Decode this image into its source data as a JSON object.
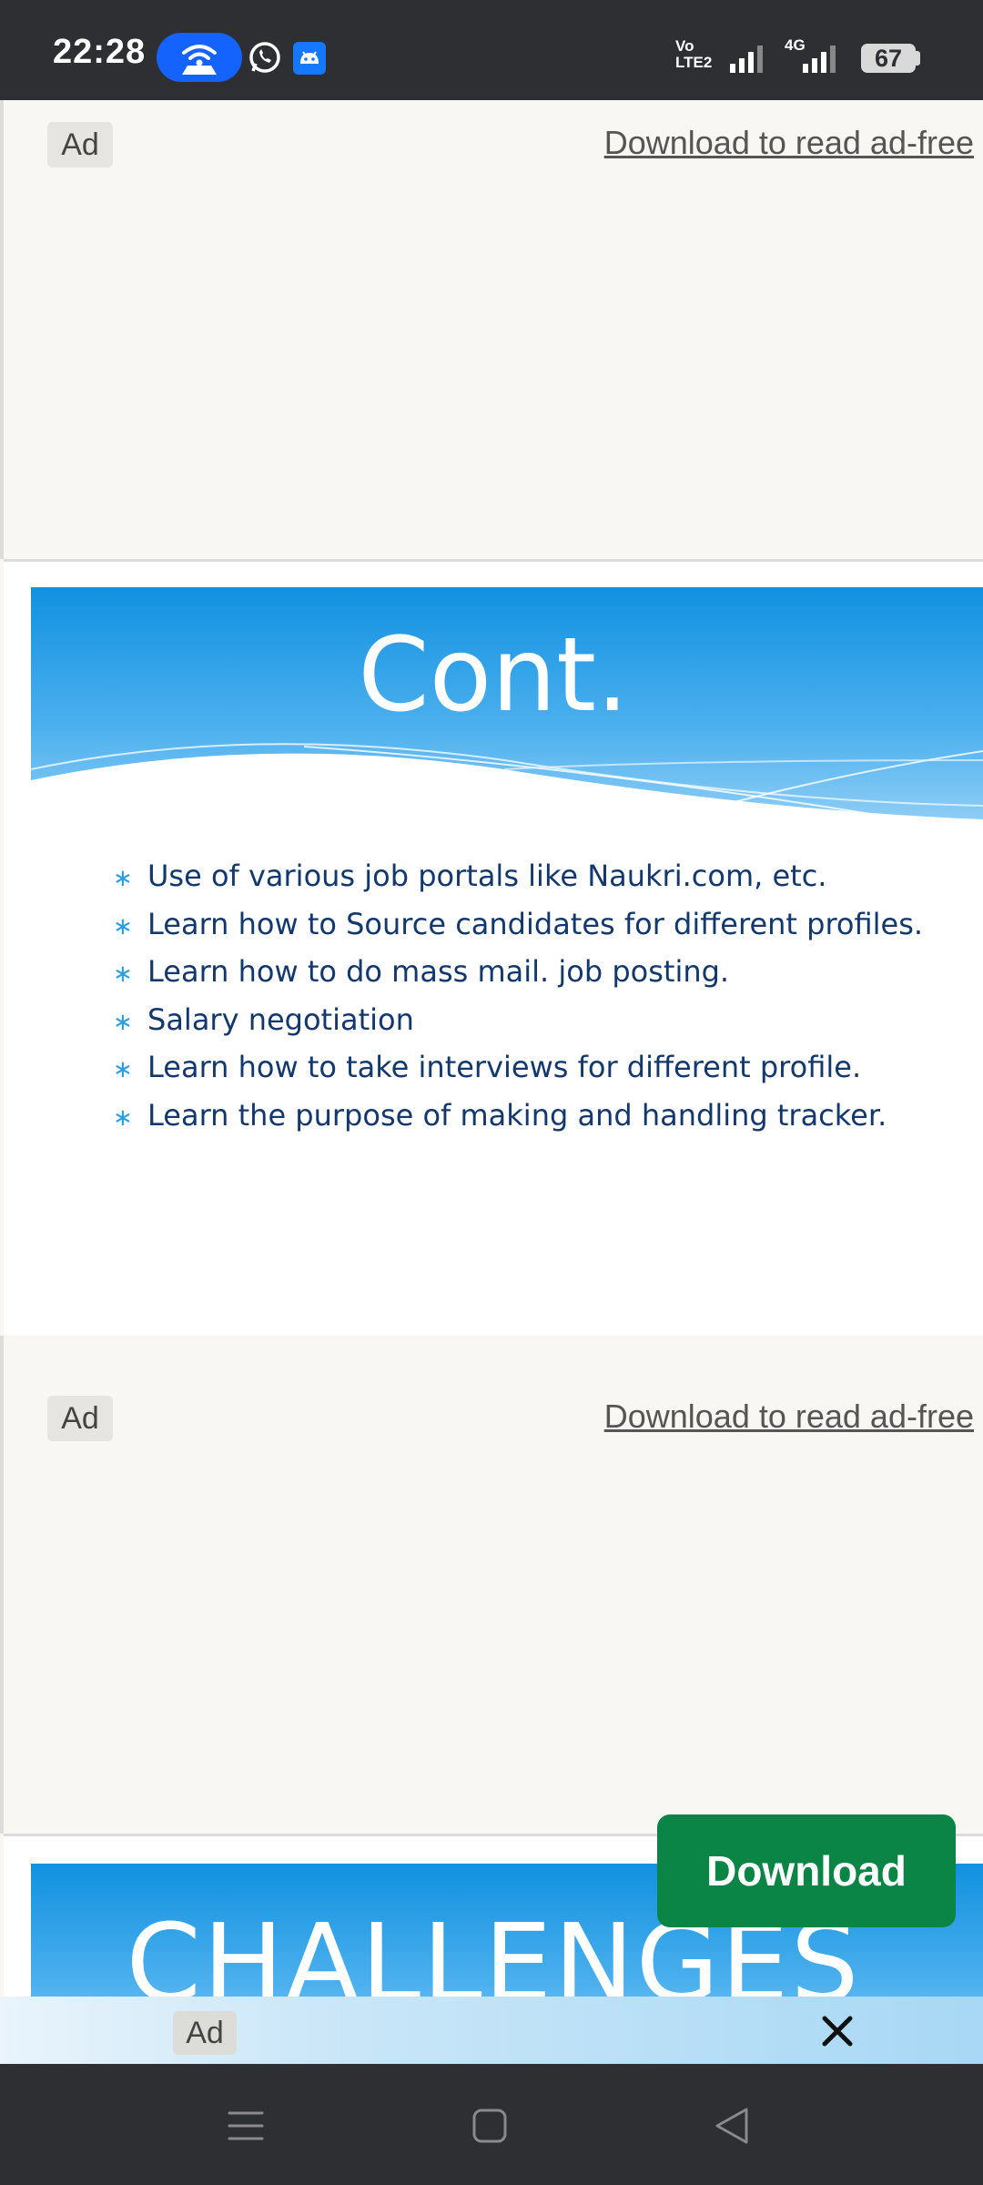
{
  "status_bar": {
    "time": "22:28",
    "volte_top": "Vo",
    "volte_bottom": "LTE2",
    "network": "4G",
    "battery": "67"
  },
  "ads": [
    {
      "badge": "Ad",
      "link": "Download to read ad-free"
    },
    {
      "badge": "Ad",
      "link": "Download to read ad-free"
    }
  ],
  "slide1": {
    "title": "Cont.",
    "bullets": [
      "Use of various job portals like Naukri.com, etc.",
      "Learn how to Source candidates for different profiles.",
      "Learn how to do mass mail. job posting.",
      "Salary negotiation",
      "Learn how to take interviews for different profile.",
      "Learn the purpose of making and handling tracker."
    ],
    "bullet_symbol": "∗"
  },
  "slide2": {
    "title": "CHALLENGES"
  },
  "download_button": "Download",
  "bottom_ad": {
    "badge": "Ad"
  },
  "colors": {
    "header_blue": "#1191e0",
    "bullet_text": "#13386e",
    "download_green": "#0b8545"
  },
  "icons": [
    "hotspot-icon",
    "whatsapp-icon",
    "android-icon",
    "signal-icon",
    "battery-icon",
    "close-icon",
    "menu-icon",
    "home-icon",
    "back-icon"
  ]
}
